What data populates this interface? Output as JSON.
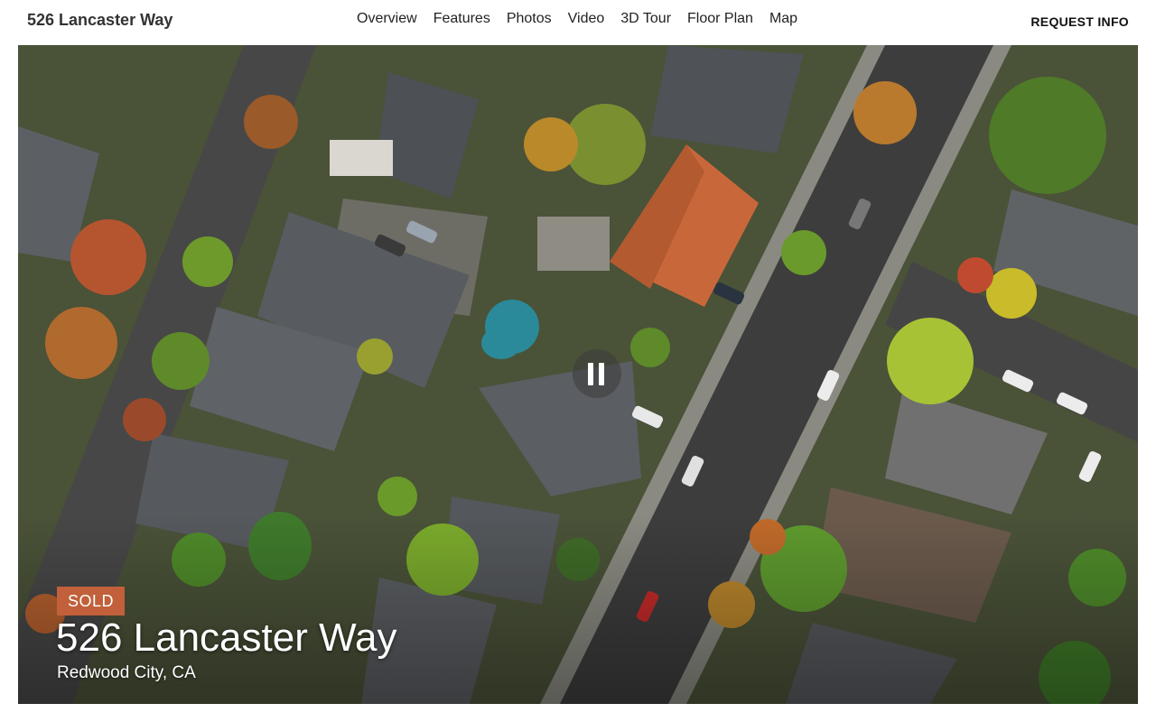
{
  "header": {
    "brand": "526 Lancaster Way",
    "nav": [
      {
        "label": "Overview"
      },
      {
        "label": "Features"
      },
      {
        "label": "Photos"
      },
      {
        "label": "Video"
      },
      {
        "label": "3D Tour"
      },
      {
        "label": "Floor Plan"
      },
      {
        "label": "Map"
      }
    ],
    "cta": "REQUEST INFO"
  },
  "hero": {
    "badge": "SOLD",
    "title": "526 Lancaster Way",
    "subtitle": "Redwood City, CA",
    "play_state_icon": "pause-icon"
  },
  "colors": {
    "badge": "#c1603a",
    "roof_accent": "#c8683a",
    "pool": "#2a8a9a",
    "foliage": "#6e8f2a",
    "street": "#444444"
  }
}
